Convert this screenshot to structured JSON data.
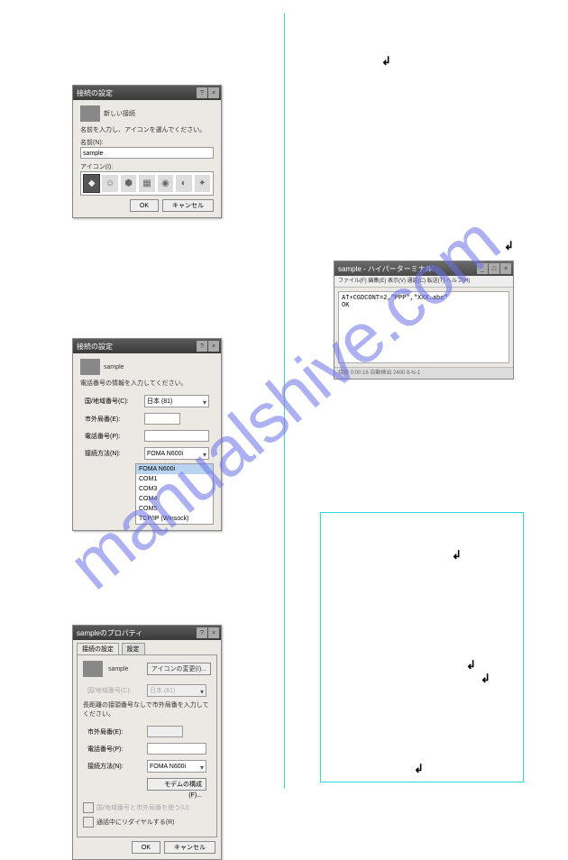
{
  "watermark": "manualshive.com",
  "enter_glyph": "↲",
  "dialog1": {
    "title": "接続の設定",
    "help": "?",
    "close": "×",
    "subtitle": "新しい接続",
    "instruction": "名前を入力し、アイコンを選んでください。",
    "name_label": "名前(N):",
    "name_value": "sample",
    "icon_label": "アイコン(I):",
    "ok": "OK",
    "cancel": "キャンセル"
  },
  "dialog2": {
    "title": "接続の設定",
    "help": "?",
    "close": "×",
    "subtitle": "sample",
    "instruction": "電話番号の情報を入力してください。",
    "country_label": "国/地域番号(C):",
    "country_value": "日本 (81)",
    "area_label": "市外局番(E):",
    "area_value": "",
    "phone_label": "電話番号(P):",
    "phone_value": "",
    "connect_label": "接続方法(N):",
    "connect_value": "FOMA N600i",
    "options": [
      "FOMA N600i",
      "COM1",
      "COM3",
      "COM4",
      "COM5",
      "TCP/IP (Winsock)"
    ]
  },
  "dialog3": {
    "title": "sampleのプロパティ",
    "help": "?",
    "close": "×",
    "tab1": "接続の設定",
    "tab2": "設定",
    "subtitle": "sample",
    "change_icon": "アイコンの変更(I)...",
    "country_label": "国/地域番号(C):",
    "country_value": "日本 (81)",
    "instruction": "長距離の接頭番号なしで市外局番を入力してください。",
    "area_label": "市外局番(E):",
    "area_value": "",
    "phone_label": "電話番号(P):",
    "phone_value": "",
    "connect_label": "接続方法(N):",
    "connect_value": "FOMA N600i",
    "modem_config": "モデムの構成(F)...",
    "cb1": "国/地域番号と市外局番を使う(U)",
    "cb2": "通話中にリダイヤルする(R)",
    "ok": "OK",
    "cancel": "キャンセル"
  },
  "terminal": {
    "title": "sample - ハイパーターミナル",
    "min": "_",
    "max": "□",
    "close": "×",
    "menu": "ファイル(F)  編集(E)  表示(V)  通話(C)  転送(T)  ヘルプ(H)",
    "line1": "AT+CGDCONT=2,\"PPP\",\"XXX.abc\"",
    "line2": "OK",
    "status": "接続 0:00:16    自動検出    2400 8-N-1"
  }
}
